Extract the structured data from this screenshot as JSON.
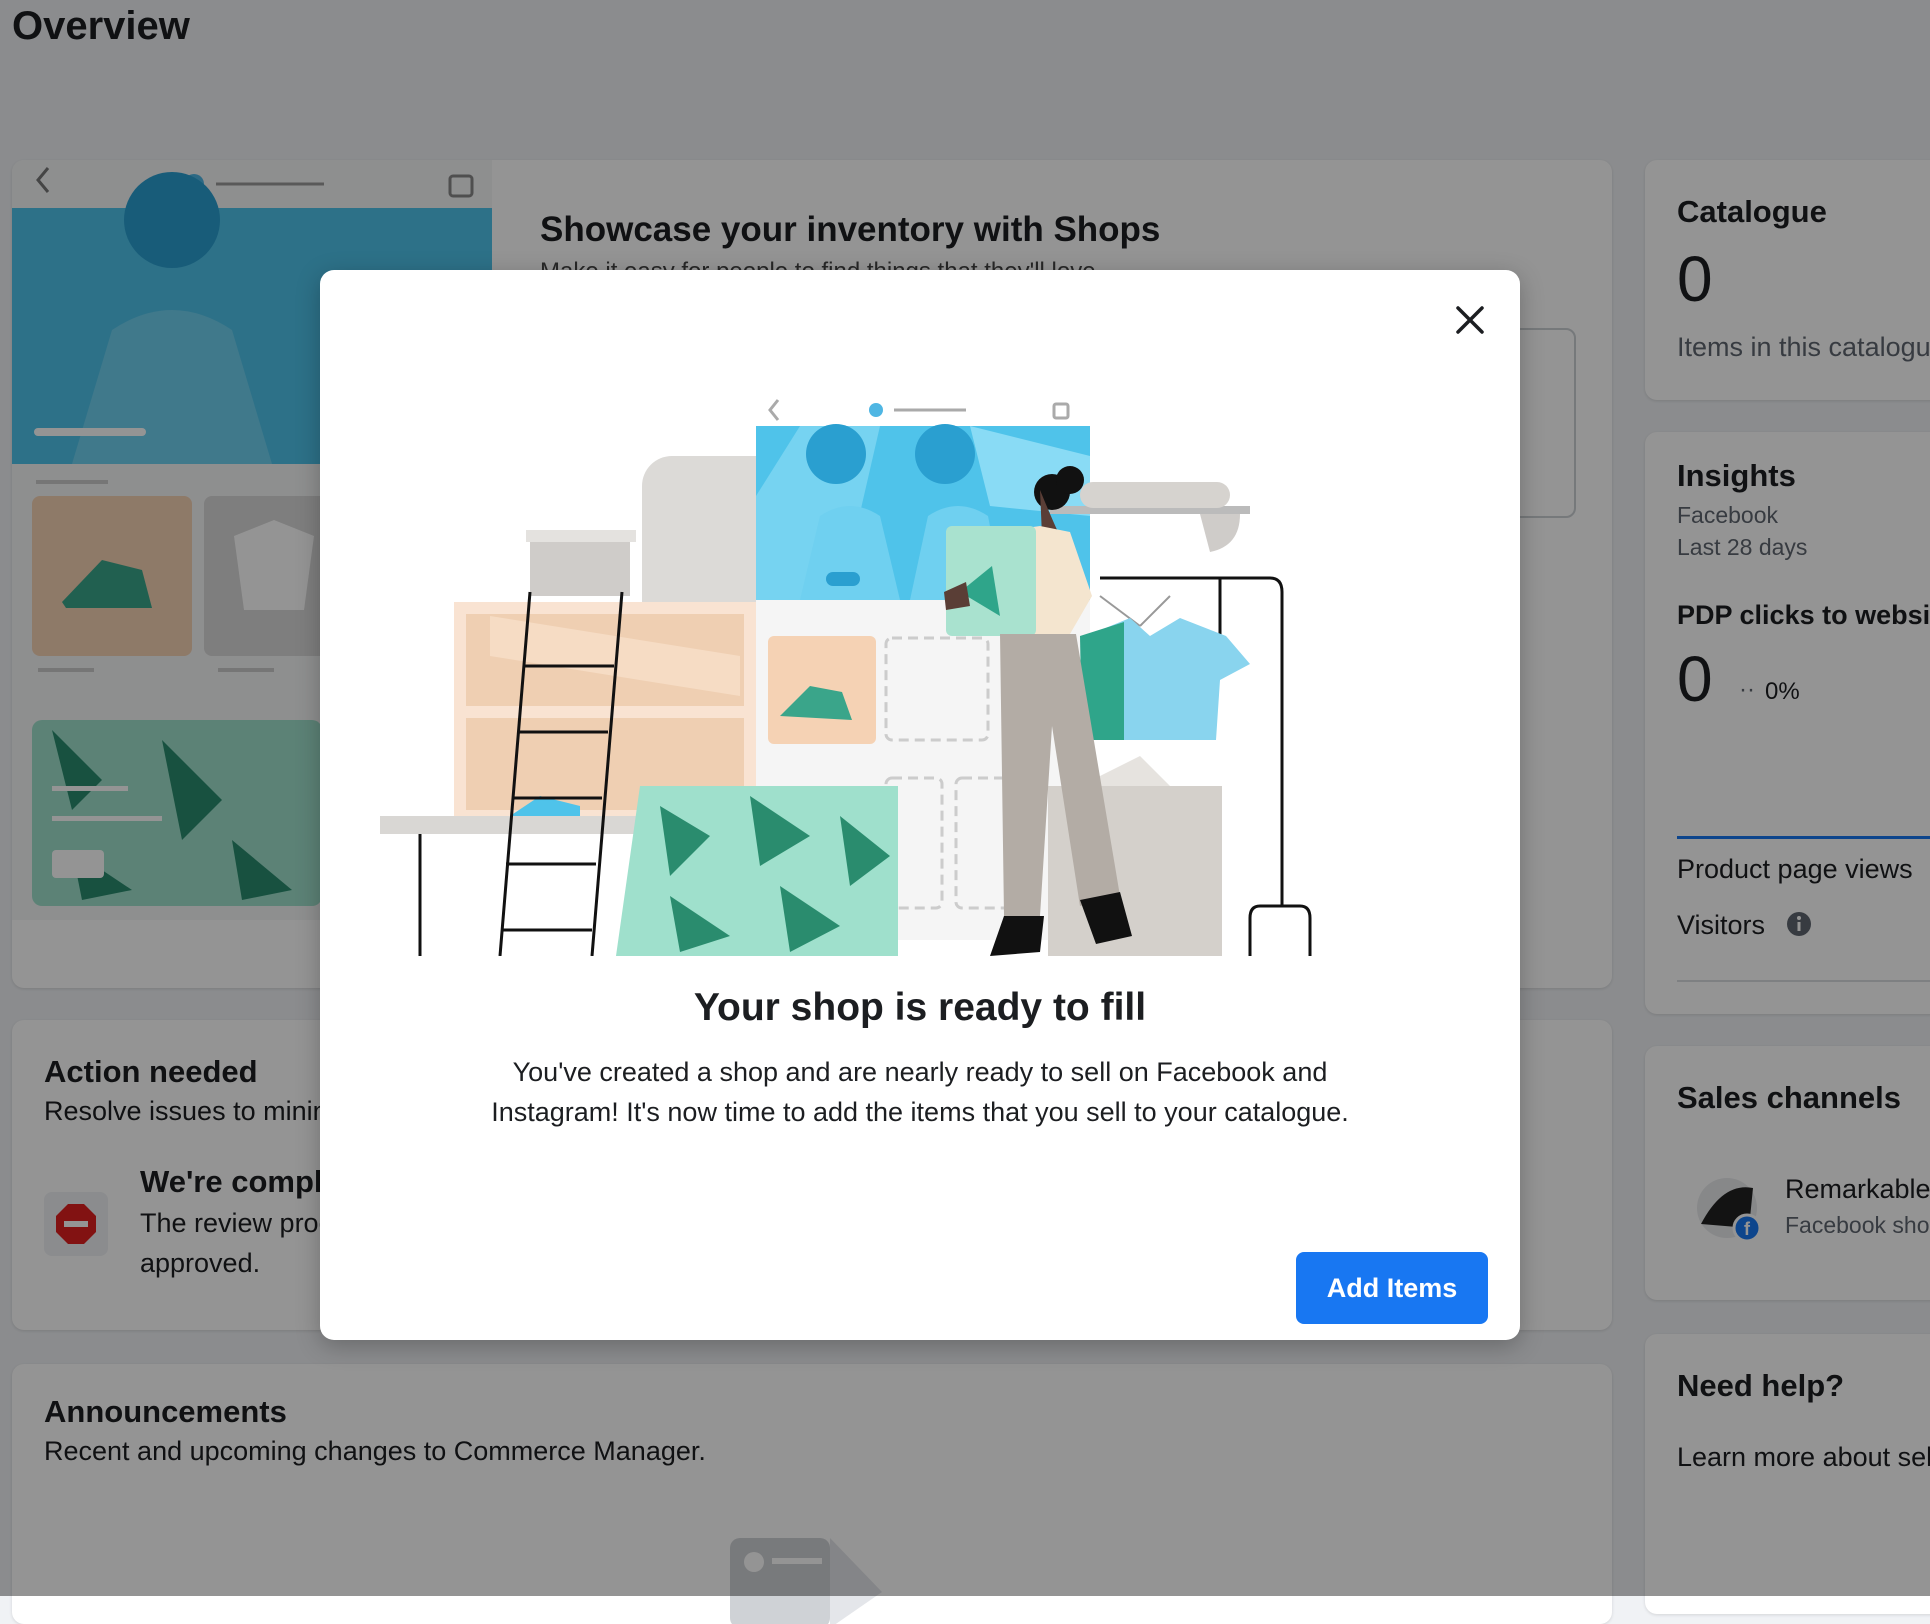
{
  "page": {
    "title": "Overview"
  },
  "showcase": {
    "title": "Showcase your inventory with Shops",
    "description": "Make it easy for people to find things that they'll love"
  },
  "catalogue": {
    "title": "Catalogue",
    "count": "0",
    "caption": "Items in this catalogue"
  },
  "insights": {
    "title": "Insights",
    "platform": "Facebook",
    "period": "Last 28 days",
    "metric_label": "PDP clicks to website",
    "metric_value": "0",
    "metric_change_symbol": "··",
    "metric_change": "0%",
    "rows": [
      "Product page views",
      "Visitors"
    ]
  },
  "action_needed": {
    "title": "Action needed",
    "subtitle": "Resolve issues to minimise",
    "item_title": "We're completing",
    "item_body_1": "The review process",
    "item_body_2": "approved."
  },
  "sales_channels": {
    "title": "Sales channels",
    "shop_name": "Remarkable",
    "shop_type": "Facebook shop"
  },
  "announcements": {
    "title": "Announcements",
    "subtitle": "Recent and upcoming changes to Commerce Manager."
  },
  "help": {
    "title": "Need help?",
    "link": "Learn more about selling"
  },
  "modal": {
    "title": "Your shop is ready to fill",
    "body": "You've created a shop and are nearly ready to sell on Facebook and Instagram! It's now time to add the items that you sell to your catalogue.",
    "primary_button": "Add Items"
  },
  "colors": {
    "accent": "#1877f2",
    "teal": "#3aa58a",
    "sky": "#4fc3ea",
    "peach": "#f5d2b4"
  },
  "icons": [
    "back-chevron-icon",
    "shopping-bag-icon",
    "close-icon",
    "info-icon",
    "stop-sign-icon",
    "facebook-badge-icon"
  ]
}
